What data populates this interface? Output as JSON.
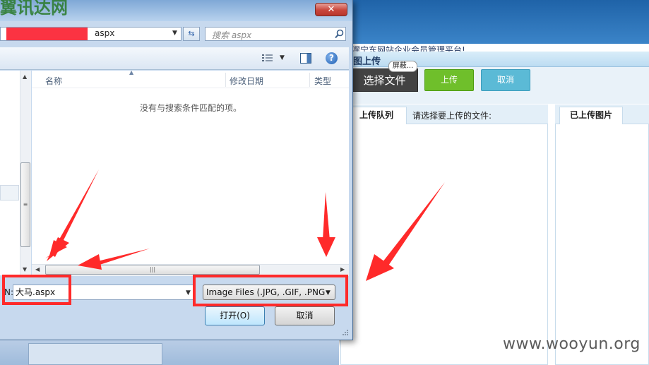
{
  "background_page": {
    "marquee": "嘿宁东网站企业会员管理平台!",
    "panel_title": "图上传",
    "tooltip": "屏蔽...",
    "buttons": {
      "select_file": "选择文件",
      "upload": "上传",
      "cancel": "取消"
    },
    "queue_tab": "上传队列",
    "queue_hint": "请选择要上传的文件:",
    "uploaded_tab": "已上传图片"
  },
  "dialog": {
    "title_fragment": "翼讯达网",
    "close_glyph": "✕",
    "address": {
      "text": "aspx"
    },
    "search": {
      "placeholder": "搜索 aspx"
    },
    "columns": [
      "名称",
      "修改日期",
      "类型"
    ],
    "empty_message": "没有与搜索条件匹配的项。",
    "filename_label": "N:",
    "filename_value": "大马.aspx",
    "file_type": "Image Files (.JPG, .GIF, .PNG",
    "open_button": "打开(O)",
    "cancel_button": "取消"
  },
  "watermark": "www.wooyun.org",
  "colors": {
    "annotation_red": "#ff2a2a",
    "upload_green": "#6fbf2b",
    "cancel_blue": "#5bbad6",
    "redaction_red": "#fb3342"
  },
  "icons": [
    "search-icon",
    "refresh-icon",
    "view-options-icon",
    "preview-pane-icon",
    "help-icon",
    "close-icon",
    "dropdown-arrow-icon",
    "resize-grip-icon"
  ]
}
